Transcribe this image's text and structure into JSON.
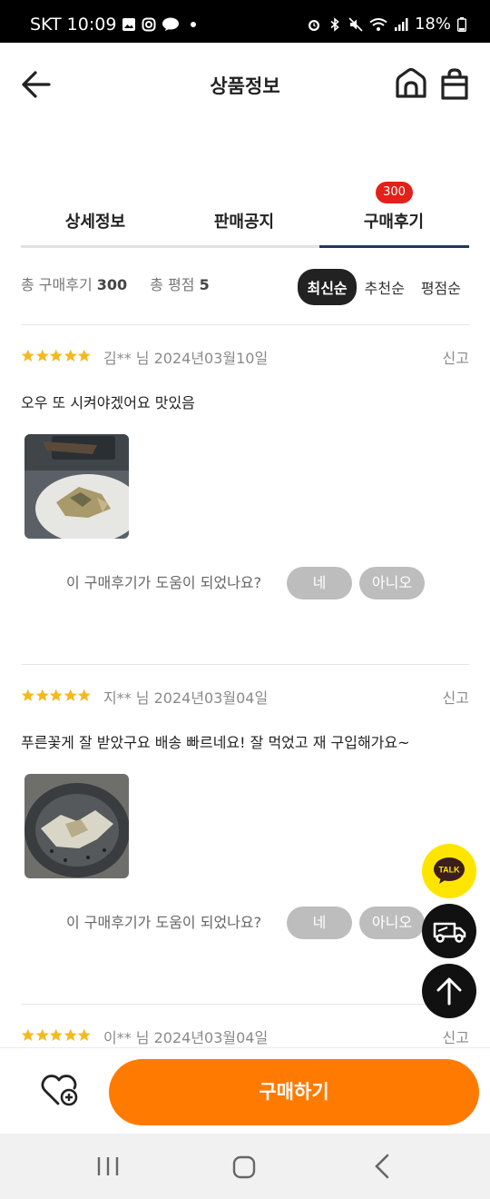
{
  "status_bar": {
    "carrier": "SKT",
    "time": "10:09",
    "battery": "18%"
  },
  "header": {
    "title": "상품정보"
  },
  "tabs": [
    {
      "label": "상세정보",
      "active": false
    },
    {
      "label": "판매공지",
      "active": false
    },
    {
      "label": "구매후기",
      "active": true,
      "badge": "300"
    }
  ],
  "summary": {
    "total_reviews_label": "총 구매후기",
    "total_reviews_value": "300",
    "total_rating_label": "총 평점",
    "total_rating_value": "5"
  },
  "sort": {
    "options": [
      "최신순",
      "추천순",
      "평점순"
    ],
    "selected": "최신순"
  },
  "reviews": [
    {
      "rating": 5,
      "author_date": "김** 님 2024년03월10일",
      "report_label": "신고",
      "text": "오우 또 시켜야겠어요 맛있음",
      "helpful_prompt": "이 구매후기가 도움이 되었나요?",
      "yes_label": "네",
      "no_label": "아니오"
    },
    {
      "rating": 5,
      "author_date": "지** 님 2024년03월04일",
      "report_label": "신고",
      "text": "푸른꽃게 잘 받았구요 배송 빠르네요! 잘 먹었고 재 구입해가요~",
      "helpful_prompt": "이 구매후기가 도움이 되었나요?",
      "yes_label": "네",
      "no_label": "아니오"
    },
    {
      "rating": 5,
      "author_date": "이** 님 2024년03월04일",
      "report_label": "신고"
    }
  ],
  "fab": {
    "talk_label": "TALK"
  },
  "bottom": {
    "buy_label": "구매하기"
  },
  "colors": {
    "accent": "#ff7a00",
    "star": "#f5b91e",
    "badge": "#e32019",
    "tab_underline": "#1f3a55",
    "talk_yellow": "#fee500"
  }
}
